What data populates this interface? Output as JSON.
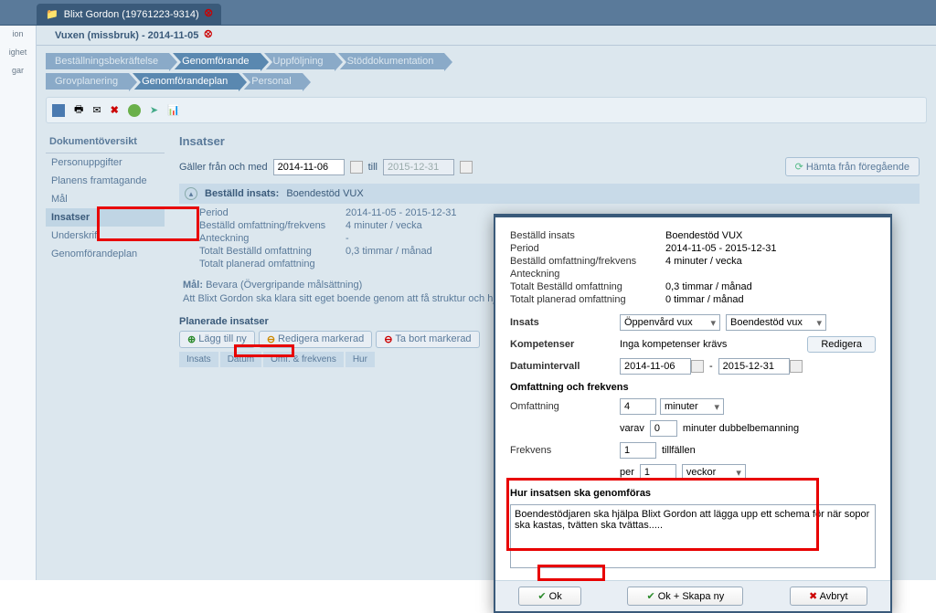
{
  "topTab": {
    "label": "Blixt Gordon (19761223-9314)"
  },
  "leftRail": [
    "ion",
    "ighet",
    "gar"
  ],
  "crumb": "Vuxen (missbruk) - 2014-11-05",
  "nav1": [
    "Beställningsbekräftelse",
    "Genomförande",
    "Uppföljning",
    "Stöddokumentation"
  ],
  "nav1Active": 1,
  "nav2": [
    "Grovplanering",
    "Genomförandeplan",
    "Personal"
  ],
  "nav2Active": 1,
  "sidebar": {
    "title": "Dokumentöversikt",
    "items": [
      "Personuppgifter",
      "Planens framtagande",
      "Mål",
      "Insatser",
      "Underskrift",
      "Genomförandeplan"
    ],
    "active": 3
  },
  "page": {
    "title": "Insatser",
    "fromLbl": "Gäller från och med",
    "from": "2014-11-06",
    "tillLbl": "till",
    "to": "2015-12-31",
    "fetch": "Hämta från föregående",
    "ordered": {
      "lbl": "Beställd insats:",
      "val": "Boendestöd VUX"
    },
    "rows": {
      "period_k": "Period",
      "period_v": "2014-11-05 - 2015-12-31",
      "bof_k": "Beställd omfattning/frekvens",
      "bof_v": "4 minuter / vecka",
      "note_k": "Anteckning",
      "note_v": "-",
      "tbo_k": "Totalt Beställd omfattning",
      "tbo_v": "0,3 timmar / månad",
      "tpo_k": "Totalt planerad omfattning",
      "tpo_v": ""
    },
    "goal": {
      "h": "Mål:",
      "sub": "Bevara (Övergripande målsättning)",
      "txt": "Att Blixt Gordon ska klara sitt eget boende genom att få struktur och hjälpmedel för att klara vardagen."
    },
    "planH": "Planerade insatser",
    "btns": {
      "add": "Lägg till ny",
      "edit": "Redigera markerad",
      "del": "Ta bort markerad"
    },
    "cols": [
      "Insats",
      "Datum",
      "Omf. & frekvens",
      "Hur"
    ]
  },
  "modal": {
    "info": {
      "bi_k": "Beställd insats",
      "bi_v": "Boendestöd VUX",
      "p_k": "Period",
      "p_v": "2014-11-05 - 2015-12-31",
      "bof_k": "Beställd omfattning/frekvens",
      "bof_v": "4 minuter / vecka",
      "a_k": "Anteckning",
      "a_v": "",
      "tbo_k": "Totalt Beställd omfattning",
      "tbo_v": "0,3 timmar / månad",
      "tpo_k": "Totalt planerad omfattning",
      "tpo_v": "0 timmar / månad"
    },
    "insats_l": "Insats",
    "insats_s1": "Öppenvård vux",
    "insats_s2": "Boendestöd vux",
    "komp_l": "Kompetenser",
    "komp_v": "Inga kompetenser krävs",
    "komp_btn": "Redigera",
    "dt_l": "Datumintervall",
    "dt_from": "2014-11-06",
    "dt_to": "2015-12-31",
    "omf_h": "Omfattning och frekvens",
    "omf_l": "Omfattning",
    "omf_n": "4",
    "omf_u": "minuter",
    "varav_l": "varav",
    "varav_n": "0",
    "varav_t": "minuter dubbelbemanning",
    "frek_l": "Frekvens",
    "frek_n": "1",
    "frek_t": "tillfällen",
    "per_l": "per",
    "per_n": "1",
    "per_u": "veckor",
    "hur_h": "Hur insatsen ska genomföras",
    "hur_txt": "Boendestödjaren ska hjälpa Blixt Gordon att lägga upp ett schema för när sopor ska kastas, tvätten ska tvättas.....",
    "ok": "Ok",
    "okNew": "Ok + Skapa ny",
    "cancel": "Avbryt"
  }
}
